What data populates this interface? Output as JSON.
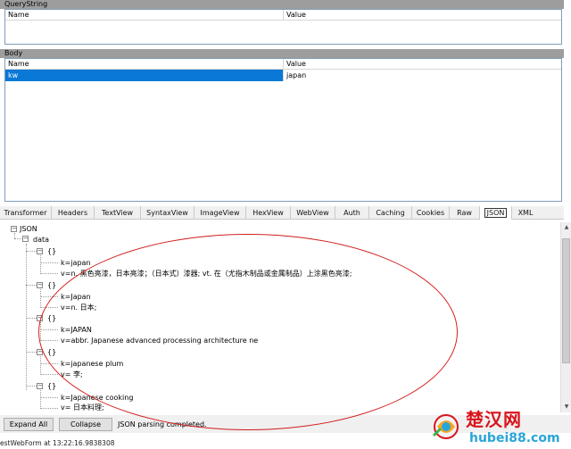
{
  "query_section": {
    "title": "QueryString",
    "columns": [
      "Name",
      "Value"
    ],
    "rows": []
  },
  "body_section": {
    "title": "Body",
    "columns": [
      "Name",
      "Value"
    ],
    "rows": [
      {
        "name": "kw",
        "value": "japan"
      }
    ]
  },
  "tabs": [
    "Transformer",
    "Headers",
    "TextView",
    "SyntaxView",
    "ImageView",
    "HexView",
    "WebView",
    "Auth",
    "Caching",
    "Cookies",
    "Raw",
    "JSON",
    "XML"
  ],
  "active_tab": "JSON",
  "tree": {
    "root": "JSON",
    "data": "data",
    "item_label": "{}",
    "items": [
      {
        "k": "k=japan",
        "v": "v=n. 黑色亮漆，日本亮漆；（日本式）漆器; vt. 在（尤指木制品或金属制品）上涂黑色亮漆;"
      },
      {
        "k": "k=Japan",
        "v": "v=n. 日本;"
      },
      {
        "k": "k=JAPAN",
        "v": "v=abbr. Japanese advanced processing architecture ne"
      },
      {
        "k": "k=japanese plum",
        "v": "v= 李;"
      },
      {
        "k": "k=Japanese cooking",
        "v": "v= 日本料理;"
      }
    ]
  },
  "footer": {
    "expand_all": "Expand All",
    "collapse": "Collapse",
    "status": "JSON parsing completed."
  },
  "statusbar": "estWebForm at 13:22:16.9838308",
  "watermark": {
    "cn": "楚汉网",
    "url": "hubei88.com"
  },
  "colors": {
    "selection": "#0a78d7",
    "annotation": "#d21e1e",
    "watermark_red": "#d9141b",
    "watermark_blue": "#2aa5d9"
  }
}
